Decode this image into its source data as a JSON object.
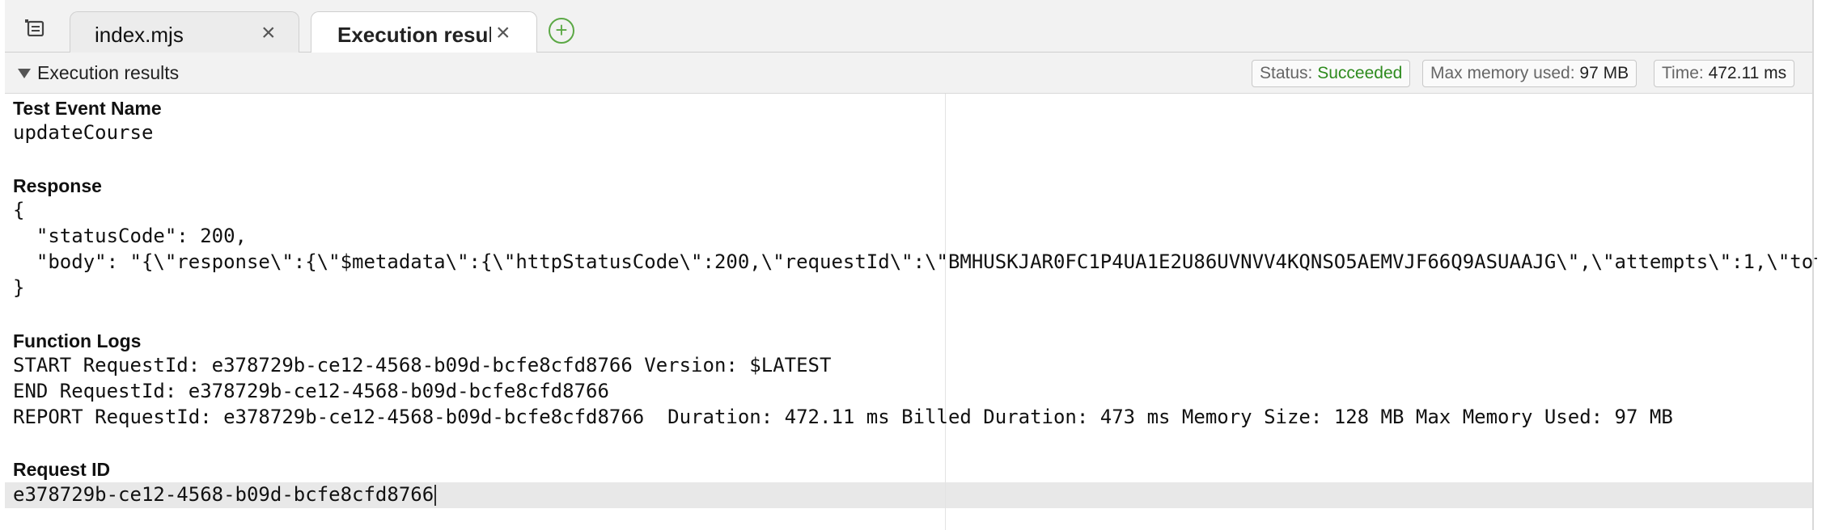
{
  "tabs": [
    {
      "label": "index.mjs",
      "active": false
    },
    {
      "label": "Execution results",
      "active": true
    }
  ],
  "results_panel": {
    "title": "Execution results",
    "status_label": "Status:",
    "status_value": "Succeeded",
    "memory_label": "Max memory used:",
    "memory_value": "97 MB",
    "time_label": "Time:",
    "time_value": "472.11 ms"
  },
  "output": {
    "test_event_heading": "Test Event Name",
    "test_event_value": "updateCourse",
    "response_heading": "Response",
    "response_lines": [
      "{",
      "  \"statusCode\": 200,",
      "  \"body\": \"{\\\"response\\\":{\\\"$metadata\\\":{\\\"httpStatusCode\\\":200,\\\"requestId\\\":\\\"BMHUSKJAR0FC1P4UA1E2U86UVNVV4KQNSO5AEMVJF66Q9ASUAAJG\\\",\\\"attempts\\\":1,\\\"tot",
      "}"
    ],
    "function_logs_heading": "Function Logs",
    "log_lines": [
      "START RequestId: e378729b-ce12-4568-b09d-bcfe8cfd8766 Version: $LATEST",
      "END RequestId: e378729b-ce12-4568-b09d-bcfe8cfd8766",
      "REPORT RequestId: e378729b-ce12-4568-b09d-bcfe8cfd8766  Duration: 472.11 ms Billed Duration: 473 ms Memory Size: 128 MB Max Memory Used: 97 MB"
    ],
    "request_id_heading": "Request ID",
    "request_id_value": "e378729b-ce12-4568-b09d-bcfe8cfd8766"
  },
  "colors": {
    "success": "#2e8b1e",
    "add_tab": "#5ba845"
  },
  "icons": [
    "menu-icon",
    "close-icon",
    "add-tab-icon",
    "collapse-caret-icon"
  ]
}
